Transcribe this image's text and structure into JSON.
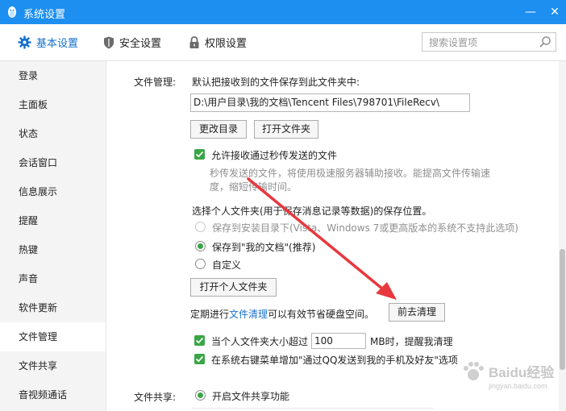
{
  "window": {
    "title": "系统设置",
    "minimize": "—",
    "close": "✕"
  },
  "tabs": [
    {
      "label": "基本设置",
      "icon": "gear-icon"
    },
    {
      "label": "安全设置",
      "icon": "shield-icon"
    },
    {
      "label": "权限设置",
      "icon": "lock-icon"
    }
  ],
  "search": {
    "placeholder": "搜索设置项"
  },
  "sidebar": {
    "items": [
      "登录",
      "主面板",
      "状态",
      "会话窗口",
      "信息展示",
      "提醒",
      "热键",
      "声音",
      "软件更新",
      "文件管理",
      "文件共享",
      "音视频通话"
    ],
    "active_index": 9
  },
  "file_mgmt": {
    "section_label": "文件管理:",
    "save_desc": "默认把接收到的文件保存到此文件夹中:",
    "path": "D:\\用户目录\\我的文档\\Tencent Files\\798701\\FileRecv\\",
    "change_dir": "更改目录",
    "open_folder": "打开文件夹",
    "allow_quick": "允许接收通过秒传发送的文件",
    "quick_desc_1": "秒传发送的文件，将使用极速服务器辅助接收。能提高文件传输速",
    "quick_desc_2": "度，缩短传输时间。",
    "personal_folder_desc": "选择个人文件夹(用于保存消息记录等数据)的保存位置。",
    "opt_install": "保存到安装目录下(Vista、Windows 7或更高版本的系统不支持此选项)",
    "opt_mydocs": "保存到\"我的文档\"(推荐)",
    "opt_custom": "自定义",
    "open_personal": "打开个人文件夹",
    "cleanup_pre": "定期进行",
    "cleanup_link": "文件清理",
    "cleanup_post": "可以有效节省硬盘空间。",
    "go_cleanup": "前去清理",
    "size_pre": "当个人文件夹大小超过",
    "size_value": "100",
    "size_post": "MB时，提醒我清理",
    "context_menu": "在系统右键菜单增加\"通过QQ发送到我的手机及好友\"选项"
  },
  "file_share": {
    "section_label": "文件共享:",
    "enable": "开启文件共享功能"
  },
  "watermark": {
    "text": "Baidu经验",
    "sub": "jingyan.baidu.com"
  },
  "colors": {
    "titlebar": "#1d8ff0",
    "accent": "#1570cc",
    "check": "#3aa545",
    "arrow": "#e8383d"
  }
}
